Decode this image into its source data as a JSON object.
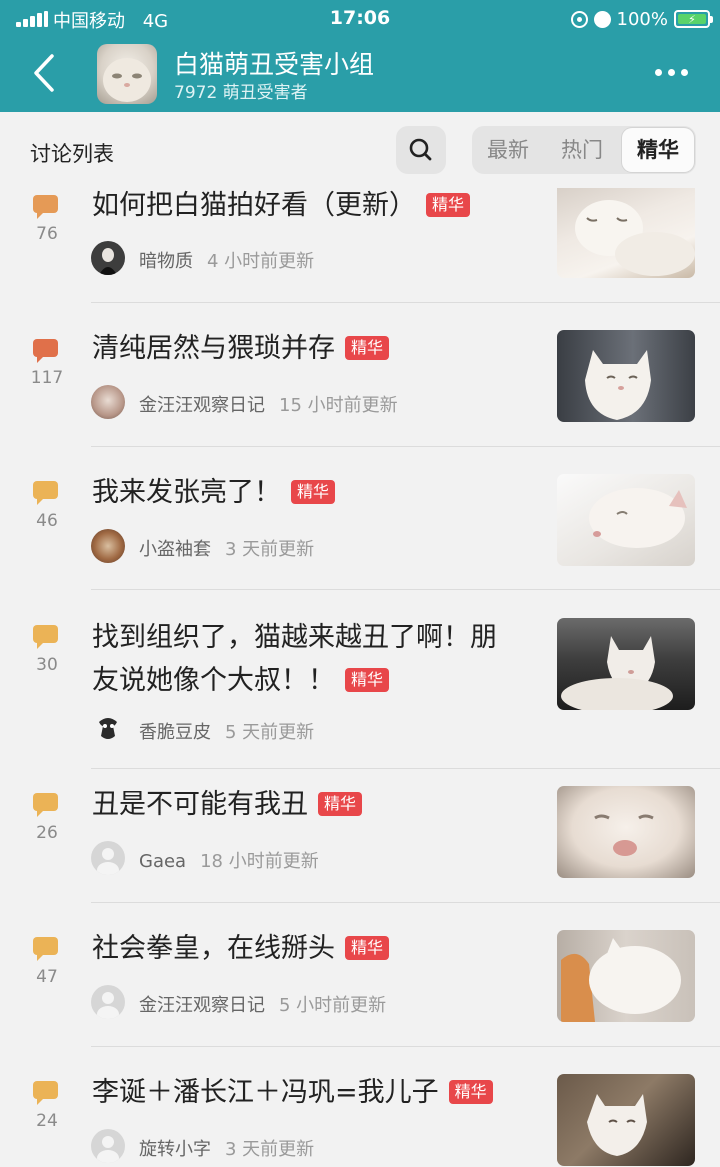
{
  "status_bar": {
    "carrier": "中国移动",
    "network": "4G",
    "time": "17:06",
    "battery": "100%"
  },
  "header": {
    "group_name": "白猫萌丑受害小组",
    "member_line": "7972 萌丑受害者",
    "accent_color": "#2a9ea8"
  },
  "subheader": {
    "label": "讨论列表",
    "tabs": [
      "最新",
      "热门",
      "精华"
    ],
    "active_tab": "精华"
  },
  "badge_label": "精华",
  "posts": [
    {
      "count": "76",
      "title": "如何把白猫拍好看（更新）",
      "author": "暗物质",
      "time": "4 小时前更新",
      "icon_color": "#e59a56"
    },
    {
      "count": "117",
      "title": "清纯居然与猥琐并存",
      "author": "金汪汪观察日记",
      "time": "15 小时前更新",
      "icon_color": "#e0704a"
    },
    {
      "count": "46",
      "title": "我来发张亮了！",
      "author": "小盗袖套",
      "time": "3 天前更新",
      "icon_color": "#ebb356"
    },
    {
      "count": "30",
      "title": "找到组织了，猫越来越丑了啊！朋友说她像个大叔！！",
      "author": "香脆豆皮",
      "time": "5 天前更新",
      "icon_color": "#ebb356"
    },
    {
      "count": "26",
      "title": "丑是不可能有我丑",
      "author": "Gaea",
      "time": "18 小时前更新",
      "icon_color": "#ebb356"
    },
    {
      "count": "47",
      "title": "社会拳皇，在线掰头",
      "author": "金汪汪观察日记",
      "time": "5 小时前更新",
      "icon_color": "#ebb356"
    },
    {
      "count": "24",
      "title": "李诞＋潘长江＋冯巩=我儿子",
      "author": "旋转小字",
      "time": "3 天前更新",
      "icon_color": "#ebb356"
    }
  ]
}
